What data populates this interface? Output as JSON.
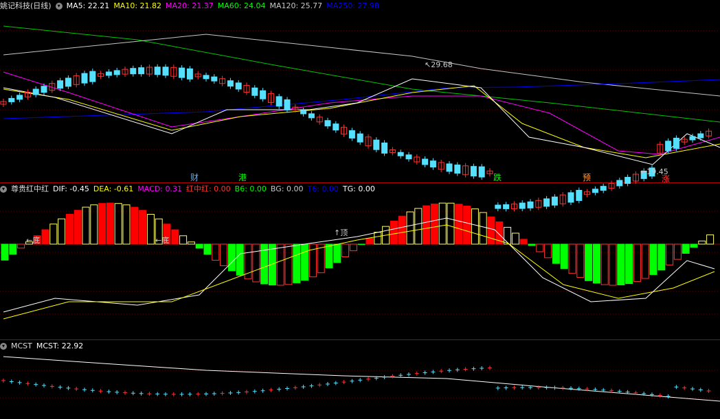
{
  "panel1": {
    "title": "姚记科技(日线)",
    "indicators": [
      {
        "label": "MA5: 22.21",
        "color": "#ffffff"
      },
      {
        "label": "MA10: 21.82",
        "color": "#ffff00"
      },
      {
        "label": "MA20: 21.37",
        "color": "#ff00ff"
      },
      {
        "label": "MA60: 24.04",
        "color": "#00ff00"
      },
      {
        "label": "MA120: 25.77",
        "color": "#c8c8c8"
      },
      {
        "label": "MA250: 27.98",
        "color": "#0000ff"
      }
    ],
    "high_label": "29.68",
    "low_label": "19.45",
    "markers": [
      {
        "text": "财",
        "color": "#6fa8dc"
      },
      {
        "text": "港",
        "color": "#00ff00"
      },
      {
        "text": "跌",
        "color": "#00ff00"
      },
      {
        "text": "预",
        "color": "#ff9933"
      },
      {
        "text": "涨",
        "color": "#ff3333"
      }
    ]
  },
  "panel2": {
    "title": "尊贵红中红",
    "indicators": [
      {
        "label": "DIF: -0.45",
        "color": "#ffffff"
      },
      {
        "label": "DEA: -0.61",
        "color": "#ffff00"
      },
      {
        "label": "MACD: 0.31",
        "color": "#ff00ff"
      },
      {
        "label": "红中红: 0.00",
        "color": "#ff3333"
      },
      {
        "label": "B6: 0.00",
        "color": "#00ff00"
      },
      {
        "label": "BG: 0.00",
        "color": "#c8c8c8"
      },
      {
        "label": "T6: 0.00",
        "color": "#0000ff"
      },
      {
        "label": "TG: 0.00",
        "color": "#ffffff"
      }
    ],
    "annotations": [
      {
        "text": "←底",
        "color": "#ffffff"
      },
      {
        "text": "←底",
        "color": "#ffffff"
      },
      {
        "text": "↑顶",
        "color": "#ffffff"
      }
    ]
  },
  "panel3": {
    "title": "MCST",
    "indicators": [
      {
        "label": "MCST: 22.92",
        "color": "#ffffff"
      }
    ]
  }
}
